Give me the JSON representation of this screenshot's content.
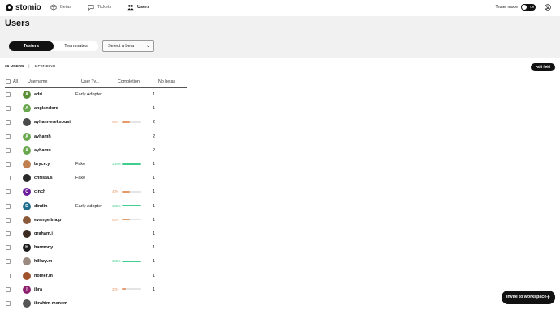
{
  "app": {
    "logo_text": "stomio"
  },
  "nav": {
    "items": [
      {
        "label": "Betas",
        "icon": "cube-icon"
      },
      {
        "label": "Tickets",
        "icon": "chat-icon"
      },
      {
        "label": "Users",
        "icon": "users-icon",
        "active": true
      }
    ],
    "tester_mode_label": "Tester mode",
    "toggle_label": "Off"
  },
  "page": {
    "title": "Users"
  },
  "segment": {
    "testers": "Testers",
    "teammates": "Teammates"
  },
  "filter": {
    "placeholder": "Select a beta"
  },
  "summary": {
    "users": "36 USERS",
    "separator": "|",
    "pending": "1 PENDING"
  },
  "add_field_label": "Add field",
  "table": {
    "headers": {
      "all": "All",
      "username": "Username",
      "user_type": "User Ty...",
      "completion": "Completion",
      "no_betas": "No betas"
    },
    "rows": [
      {
        "username": "adri",
        "type": "Early Adopter",
        "completion": null,
        "betas": "1",
        "initial": "A",
        "avatar_color": "#5a8f3a"
      },
      {
        "username": "anglandord",
        "type": "",
        "completion": null,
        "betas": "1",
        "initial": "A",
        "avatar_color": "#6aa84f"
      },
      {
        "username": "ayham-ereksousi",
        "type": "",
        "completion": "43%",
        "completion_value": 0.43,
        "betas": "2",
        "initial": "",
        "avatar_color": "#4a4a4a"
      },
      {
        "username": "ayhamh",
        "type": "",
        "completion": null,
        "betas": "2",
        "initial": "A",
        "avatar_color": "#6aa84f"
      },
      {
        "username": "ayhamn",
        "type": "",
        "completion": null,
        "betas": "2",
        "initial": "A",
        "avatar_color": "#6aa84f"
      },
      {
        "username": "bryce.y",
        "type": "Fake",
        "completion": "100%",
        "completion_value": 1.0,
        "betas": "1",
        "initial": "",
        "avatar_color": "#c08050"
      },
      {
        "username": "christa.s",
        "type": "Fake",
        "completion": null,
        "betas": "1",
        "initial": "",
        "avatar_color": "#2a2a2a"
      },
      {
        "username": "cinch",
        "type": "",
        "completion": "40%",
        "completion_value": 0.4,
        "betas": "1",
        "initial": "C",
        "avatar_color": "#6a1b9a"
      },
      {
        "username": "dindin",
        "type": "Early Adopter",
        "completion": "100%",
        "completion_value": 1.0,
        "betas": "1",
        "initial": "D",
        "avatar_color": "#1f6e8c"
      },
      {
        "username": "evangelina.p",
        "type": "",
        "completion": "40%",
        "completion_value": 0.4,
        "betas": "1",
        "initial": "",
        "avatar_color": "#8a5a3a"
      },
      {
        "username": "graham.j",
        "type": "",
        "completion": null,
        "betas": "1",
        "initial": "",
        "avatar_color": "#3a2a20"
      },
      {
        "username": "harmony",
        "type": "",
        "completion": null,
        "betas": "1",
        "initial": "H",
        "avatar_color": "#1c1c1c"
      },
      {
        "username": "hillary.m",
        "type": "",
        "completion": "100%",
        "completion_value": 1.0,
        "betas": "1",
        "initial": "",
        "avatar_color": "#9a8a80"
      },
      {
        "username": "homer.m",
        "type": "",
        "completion": null,
        "betas": "1",
        "initial": "",
        "avatar_color": "#a0522d"
      },
      {
        "username": "ibra",
        "type": "",
        "completion": "20%",
        "completion_value": 0.2,
        "betas": "1",
        "initial": "I",
        "avatar_color": "#8e1f6e"
      },
      {
        "username": "ibrahim-menem",
        "type": "",
        "completion": null,
        "betas": "",
        "initial": "",
        "avatar_color": "#555555"
      }
    ]
  },
  "invite_label": "Invite to workspace",
  "colors": {
    "low": "#e69a6a",
    "high": "#3ecf8e",
    "dark": "#111111"
  }
}
